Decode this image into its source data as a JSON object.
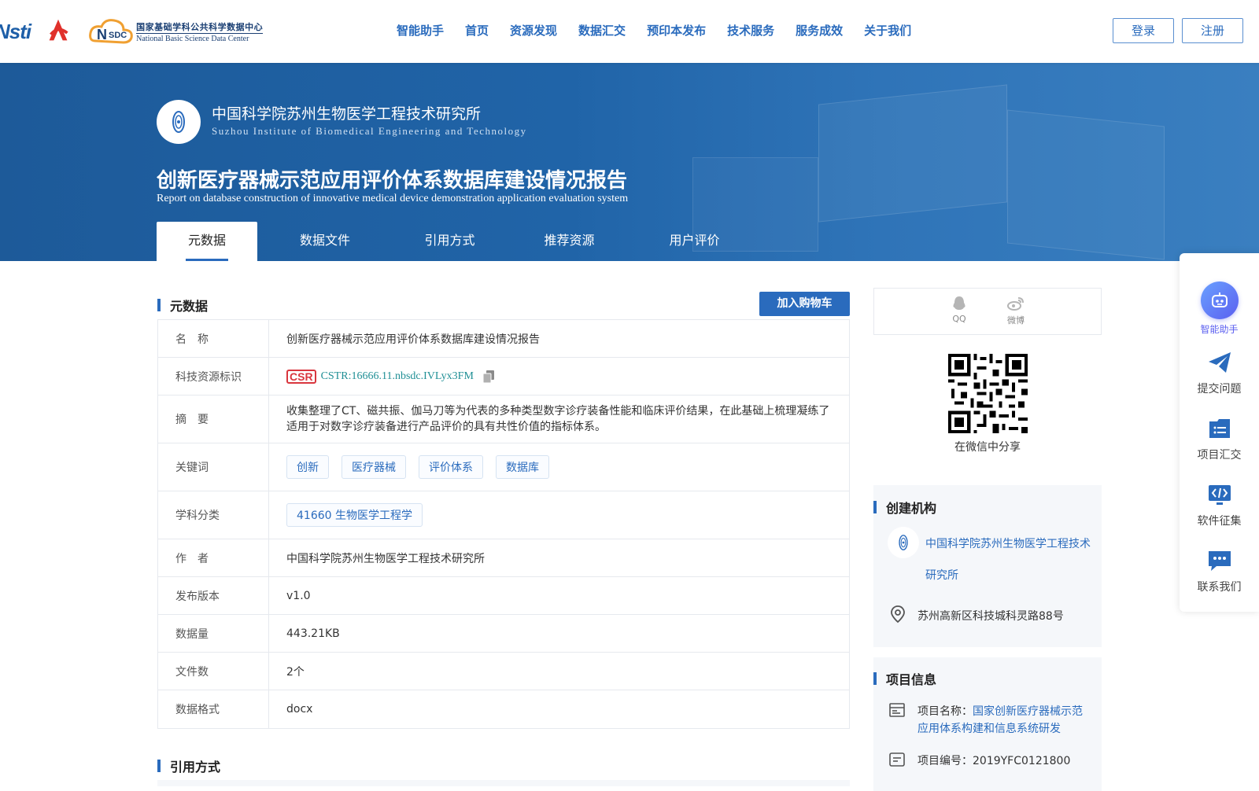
{
  "header": {
    "logo_nsti": "Nsti",
    "logo_nsdc_cn": "国家基础学科公共科学数据中心",
    "logo_nsdc_en": "National Basic Science Data Center",
    "nav": [
      "智能助手",
      "首页",
      "资源发现",
      "数据汇交",
      "预印本发布",
      "技术服务",
      "服务成效",
      "关于我们"
    ],
    "login": "登录",
    "register": "注册"
  },
  "banner": {
    "institute_cn": "中国科学院苏州生物医学工程技术研究所",
    "institute_en": "Suzhou Institute of Biomedical Engineering and Technology",
    "title_cn": "创新医疗器械示范应用评价体系数据库建设情况报告",
    "title_en": "Report on database construction of innovative medical device demonstration application evaluation system",
    "tabs": [
      "元数据",
      "数据文件",
      "引用方式",
      "推荐资源",
      "用户评价"
    ]
  },
  "metadata": {
    "section_title": "元数据",
    "cart_button": "加入购物车",
    "rows": {
      "name_label": "名　称",
      "name_value": "创新医疗器械示范应用评价体系数据库建设情况报告",
      "cstr_label": "科技资源标识",
      "cstr_badge": "CSR",
      "cstr_value": "CSTR:16666.11.nbsdc.IVLyx3FM",
      "abstract_label": "摘　要",
      "abstract_value": "收集整理了CT、磁共振、伽马刀等为代表的多种类型数字诊疗装备性能和临床评价结果，在此基础上梳理凝练了适用于对数字诊疗装备进行产品评价的具有共性价值的指标体系。",
      "keywords_label": "关键词",
      "keywords": [
        "创新",
        "医疗器械",
        "评价体系",
        "数据库"
      ],
      "subject_label": "学科分类",
      "subject_value": "41660 生物医学工程学",
      "author_label": "作　者",
      "author_value": "中国科学院苏州生物医学工程技术研究所",
      "version_label": "发布版本",
      "version_value": "v1.0",
      "size_label": "数据量",
      "size_value": "443.21KB",
      "files_label": "文件数",
      "files_value": "2个",
      "format_label": "数据格式",
      "format_value": "docx"
    }
  },
  "citation": {
    "section_title": "引用方式"
  },
  "share": {
    "qq": "QQ",
    "weibo": "微博",
    "wechat_caption": "在微信中分享"
  },
  "creator": {
    "section_title": "创建机构",
    "org_name": "中国科学院苏州生物医学工程技术研究所",
    "address": "苏州高新区科技城科灵路88号"
  },
  "project": {
    "section_title": "项目信息",
    "name_label": "项目名称：",
    "name_value": "国家创新医疗器械示范应用体系构建和信息系统研发",
    "number_label": "项目编号：",
    "number_value": "2019YFC0121800"
  },
  "float_bar": {
    "items": [
      "智能助手",
      "提交问题",
      "项目汇交",
      "软件征集",
      "联系我们"
    ],
    "accent": "#5b5ff0"
  },
  "colors": {
    "brand_blue": "#2a6bbd",
    "banner_blue": "#1d5a99",
    "cstr_teal": "#1f8f95"
  }
}
